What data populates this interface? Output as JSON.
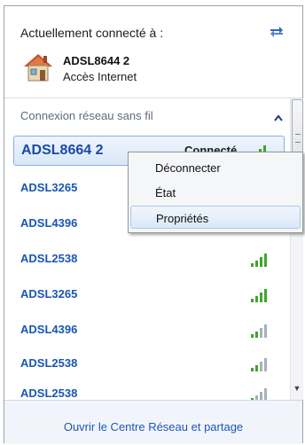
{
  "header": {
    "title": "Actuellement connecté à :",
    "current_network": "ADSL8644 2",
    "current_status": "Accès Internet"
  },
  "section": {
    "title": "Connexion réseau sans fil"
  },
  "networks": [
    {
      "name": "ADSL8664 2",
      "status": "Connecté"
    },
    {
      "name": "ADSL3265",
      "status": ""
    },
    {
      "name": "ADSL4396",
      "status": ""
    },
    {
      "name": "ADSL2538",
      "status": ""
    },
    {
      "name": "ADSL3265",
      "status": ""
    },
    {
      "name": "ADSL4396",
      "status": ""
    },
    {
      "name": "ADSL2538",
      "status": ""
    },
    {
      "name": "ADSL2538",
      "status": ""
    }
  ],
  "context_menu": {
    "items": [
      "Déconnecter",
      "État",
      "Propriétés"
    ],
    "highlighted": "Propriétés"
  },
  "footer": {
    "link": "Ouvrir le Centre Réseau et partage"
  },
  "icons": {
    "refresh": "refresh-icon",
    "house": "house-icon",
    "collapse": "chevron-up-icon",
    "signal": "signal-strength-icon"
  },
  "colors": {
    "accent": "#1a55b5",
    "selection": "#d8e8f8",
    "signal_green": "#3fa52d"
  }
}
